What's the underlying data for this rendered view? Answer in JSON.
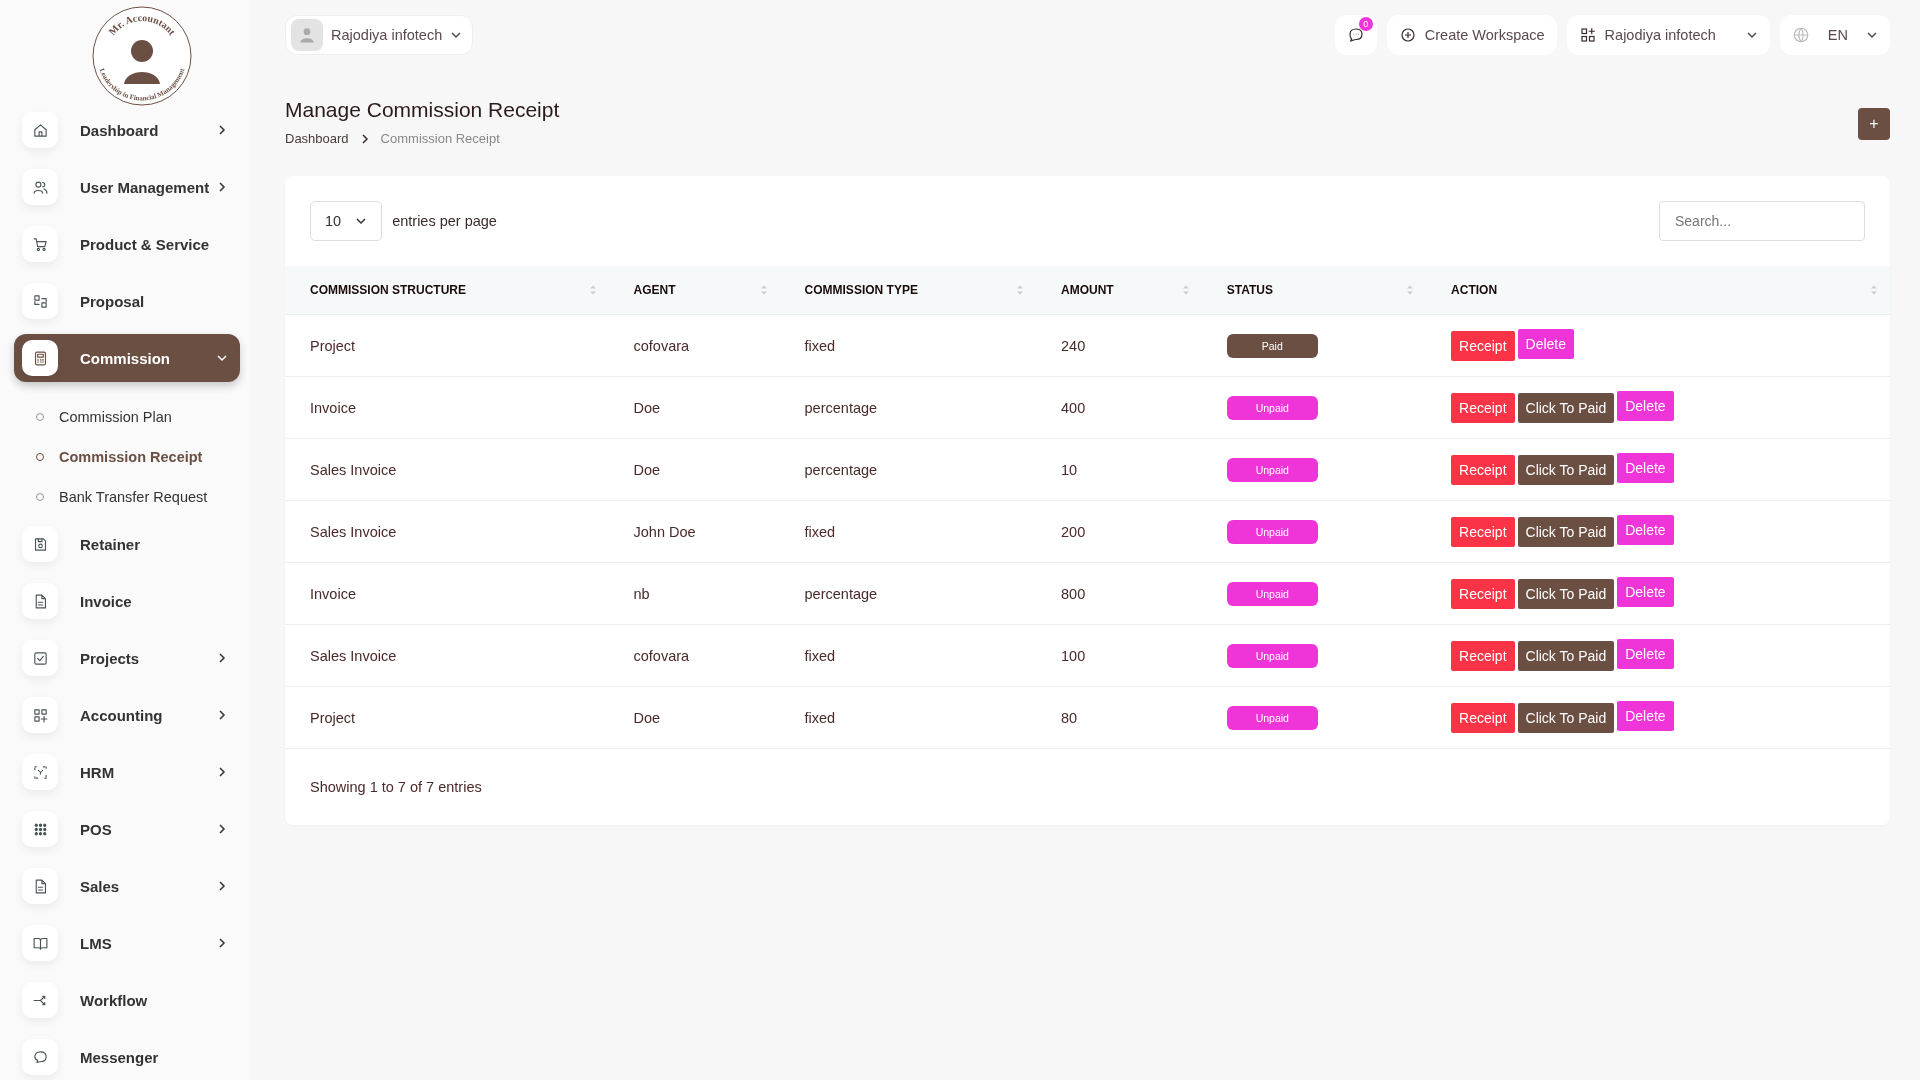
{
  "logo": {
    "top_text": "Mr. Accountant",
    "bottom_text": "Leadership in Financial Management"
  },
  "sidebar": {
    "items": [
      {
        "label": "Dashboard",
        "expanded": false,
        "selected": false
      },
      {
        "label": "User Management",
        "expanded": false,
        "selected": false
      },
      {
        "label": "Product & Service",
        "selected": false
      },
      {
        "label": "Proposal",
        "selected": false
      },
      {
        "label": "Commission",
        "expanded": true,
        "selected": true,
        "children": [
          {
            "label": "Commission Plan",
            "selected": false
          },
          {
            "label": "Commission Receipt",
            "selected": true
          },
          {
            "label": "Bank Transfer Request",
            "selected": false
          }
        ]
      },
      {
        "label": "Retainer",
        "selected": false
      },
      {
        "label": "Invoice",
        "selected": false
      },
      {
        "label": "Projects",
        "expanded": false,
        "selected": false
      },
      {
        "label": "Accounting",
        "expanded": false,
        "selected": false
      },
      {
        "label": "HRM",
        "expanded": false,
        "selected": false
      },
      {
        "label": "POS",
        "expanded": false,
        "selected": false
      },
      {
        "label": "Sales",
        "expanded": false,
        "selected": false
      },
      {
        "label": "LMS",
        "expanded": false,
        "selected": false
      },
      {
        "label": "Workflow",
        "selected": false
      },
      {
        "label": "Messenger",
        "selected": false
      }
    ]
  },
  "topbar": {
    "user": "Rajodiya infotech",
    "message_count": "0",
    "create_workspace": "Create Workspace",
    "workspace": "Rajodiya infotech",
    "language": "EN"
  },
  "page": {
    "title": "Manage Commission Receipt",
    "breadcrumb": [
      "Dashboard",
      "Commission Receipt"
    ],
    "add_button": "+"
  },
  "table": {
    "page_size": "10",
    "page_size_label": "entries per page",
    "search_placeholder": "Search...",
    "columns": [
      "COMMISSION STRUCTURE",
      "AGENT",
      "COMMISSION TYPE",
      "AMOUNT",
      "STATUS",
      "ACTION"
    ],
    "rows": [
      {
        "structure": "Project",
        "agent": "cofovara",
        "type": "fixed",
        "amount": "240",
        "status": {
          "label": "Paid",
          "kind": "paid"
        },
        "actions": [
          {
            "label": "Receipt",
            "kind": "receipt"
          },
          {
            "label": "Delete",
            "kind": "delete"
          }
        ]
      },
      {
        "structure": "Invoice",
        "agent": "Doe",
        "type": "percentage",
        "amount": "400",
        "status": {
          "label": "Unpaid",
          "kind": "unpaid"
        },
        "actions": [
          {
            "label": "Receipt",
            "kind": "receipt"
          },
          {
            "label": "Click To Paid",
            "kind": "pay"
          },
          {
            "label": "Delete",
            "kind": "delete"
          }
        ]
      },
      {
        "structure": "Sales Invoice",
        "agent": "Doe",
        "type": "percentage",
        "amount": "10",
        "status": {
          "label": "Unpaid",
          "kind": "unpaid"
        },
        "actions": [
          {
            "label": "Receipt",
            "kind": "receipt"
          },
          {
            "label": "Click To Paid",
            "kind": "pay"
          },
          {
            "label": "Delete",
            "kind": "delete"
          }
        ]
      },
      {
        "structure": "Sales Invoice",
        "agent": "John Doe",
        "type": "fixed",
        "amount": "200",
        "status": {
          "label": "Unpaid",
          "kind": "unpaid"
        },
        "actions": [
          {
            "label": "Receipt",
            "kind": "receipt"
          },
          {
            "label": "Click To Paid",
            "kind": "pay"
          },
          {
            "label": "Delete",
            "kind": "delete"
          }
        ]
      },
      {
        "structure": "Invoice",
        "agent": "nb",
        "type": "percentage",
        "amount": "800",
        "status": {
          "label": "Unpaid",
          "kind": "unpaid"
        },
        "actions": [
          {
            "label": "Receipt",
            "kind": "receipt"
          },
          {
            "label": "Click To Paid",
            "kind": "pay"
          },
          {
            "label": "Delete",
            "kind": "delete"
          }
        ]
      },
      {
        "structure": "Sales Invoice",
        "agent": "cofovara",
        "type": "fixed",
        "amount": "100",
        "status": {
          "label": "Unpaid",
          "kind": "unpaid"
        },
        "actions": [
          {
            "label": "Receipt",
            "kind": "receipt"
          },
          {
            "label": "Click To Paid",
            "kind": "pay"
          },
          {
            "label": "Delete",
            "kind": "delete"
          }
        ]
      },
      {
        "structure": "Project",
        "agent": "Doe",
        "type": "fixed",
        "amount": "80",
        "status": {
          "label": "Unpaid",
          "kind": "unpaid"
        },
        "actions": [
          {
            "label": "Receipt",
            "kind": "receipt"
          },
          {
            "label": "Click To Paid",
            "kind": "pay"
          },
          {
            "label": "Delete",
            "kind": "delete"
          }
        ]
      }
    ],
    "footer": "Showing 1 to 7 of 7 entries"
  }
}
